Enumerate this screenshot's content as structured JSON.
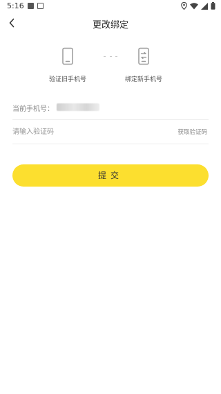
{
  "status_bar": {
    "time": "5:16",
    "icons": [
      "notification-square-icon",
      "notification-photo-icon",
      "location-icon",
      "wifi-icon",
      "signal-icon",
      "battery-icon"
    ]
  },
  "nav": {
    "title": "更改绑定",
    "back_icon": "chevron-left-icon"
  },
  "steps": [
    {
      "label": "验证旧手机号",
      "icon": "phone-icon"
    },
    {
      "label": "绑定新手机号",
      "icon": "phone-switch-icon"
    }
  ],
  "form": {
    "current_phone_label": "当前手机号：",
    "code_placeholder": "请输入验证码",
    "code_value": "",
    "get_code_label": "获取验证码"
  },
  "submit": {
    "label": "提交"
  },
  "colors": {
    "accent": "#fcdf2f",
    "icon_gray": "#9a9a9a",
    "divider": "#eeeeee"
  }
}
